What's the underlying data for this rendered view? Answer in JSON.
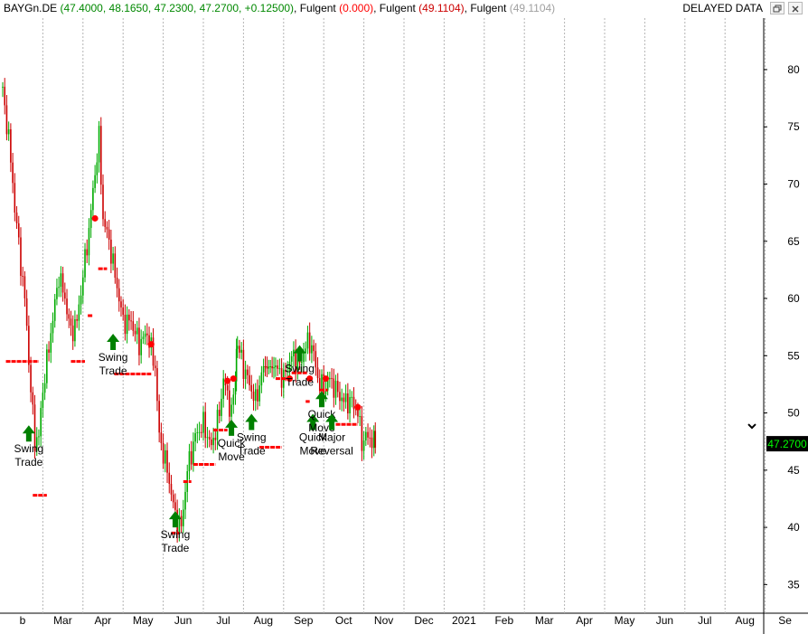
{
  "header": {
    "symbol": "BAYGn.DE",
    "ohlc": "(47.4000, 48.1650, 47.2300, 47.2700, +0.12500)",
    "ind1_name": "Fulgent",
    "ind1_value": "(0.000)",
    "ind2_name": "Fulgent",
    "ind2_value": "(49.1104)",
    "ind3_name": "Fulgent",
    "ind3_value": "(49.1104)",
    "status": "DELAYED DATA",
    "colors": {
      "symbol": "#000000",
      "ohlc": "#008800",
      "ind1": "#ff0000",
      "ind2": "#cc0000",
      "ind3": "#a0a0a0"
    },
    "window_icons": [
      "restore-icon",
      "close-icon"
    ]
  },
  "chart_data": {
    "type": "candlestick",
    "x_axis_labels": [
      {
        "label": "b",
        "month_index": 0
      },
      {
        "label": "Mar",
        "month_index": 1
      },
      {
        "label": "Apr",
        "month_index": 2
      },
      {
        "label": "May",
        "month_index": 3
      },
      {
        "label": "Jun",
        "month_index": 4
      },
      {
        "label": "Jul",
        "month_index": 5
      },
      {
        "label": "Aug",
        "month_index": 6
      },
      {
        "label": "Sep",
        "month_index": 7
      },
      {
        "label": "Oct",
        "month_index": 8
      },
      {
        "label": "Nov",
        "month_index": 9
      },
      {
        "label": "Dec",
        "month_index": 10
      },
      {
        "label": "2021",
        "month_index": 11
      },
      {
        "label": "Feb",
        "month_index": 12
      },
      {
        "label": "Mar",
        "month_index": 13
      },
      {
        "label": "Apr",
        "month_index": 14
      },
      {
        "label": "May",
        "month_index": 15
      },
      {
        "label": "Jun",
        "month_index": 16
      },
      {
        "label": "Jul",
        "month_index": 17
      },
      {
        "label": "Aug",
        "month_index": 18
      },
      {
        "label": "Se",
        "month_index": 19
      }
    ],
    "y_ticks": [
      35,
      40,
      45,
      50,
      55,
      60,
      65,
      70,
      75,
      80
    ],
    "ylim": [
      32.5,
      84.5
    ],
    "last_price": "47.2700",
    "last_price_value": 47.27,
    "colors": {
      "up": "#00aa00",
      "down": "#cc0000",
      "stop_line": "#ff0000",
      "stop_dot": "#ff0000",
      "arrow": "#008000",
      "grid": "#b4b4b4",
      "last_price_bg": "#000000",
      "last_price_fg": "#00ff00"
    },
    "price_path": [
      [
        0,
        78
      ],
      [
        0.15,
        74
      ],
      [
        0.3,
        68
      ],
      [
        0.45,
        63
      ],
      [
        0.55,
        60
      ],
      [
        0.7,
        52
      ],
      [
        0.8,
        47.5
      ],
      [
        0.9,
        48
      ],
      [
        1.0,
        52
      ],
      [
        1.2,
        57
      ],
      [
        1.4,
        62
      ],
      [
        1.55,
        60
      ],
      [
        1.7,
        57
      ],
      [
        1.85,
        58
      ],
      [
        2.0,
        62
      ],
      [
        2.15,
        66
      ],
      [
        2.3,
        71
      ],
      [
        2.4,
        74
      ],
      [
        2.5,
        67
      ],
      [
        2.65,
        65
      ],
      [
        2.8,
        62
      ],
      [
        3.0,
        58
      ],
      [
        3.2,
        58
      ],
      [
        3.4,
        56
      ],
      [
        3.6,
        57
      ],
      [
        3.8,
        54
      ],
      [
        3.9,
        48
      ],
      [
        4.1,
        45
      ],
      [
        4.3,
        41
      ],
      [
        4.45,
        40
      ],
      [
        4.6,
        45
      ],
      [
        4.8,
        48
      ],
      [
        5.0,
        49
      ],
      [
        5.2,
        47
      ],
      [
        5.4,
        50
      ],
      [
        5.5,
        53
      ],
      [
        5.7,
        50
      ],
      [
        5.8,
        53
      ],
      [
        5.85,
        56
      ],
      [
        6.0,
        54
      ],
      [
        6.2,
        52
      ],
      [
        6.3,
        51
      ],
      [
        6.5,
        54
      ],
      [
        6.8,
        54
      ],
      [
        7.0,
        53
      ],
      [
        7.2,
        55
      ],
      [
        7.4,
        54
      ],
      [
        7.55,
        56
      ],
      [
        7.7,
        56
      ],
      [
        7.85,
        53
      ],
      [
        8.0,
        52
      ],
      [
        8.15,
        53
      ],
      [
        8.3,
        52
      ],
      [
        8.5,
        51
      ],
      [
        8.7,
        51
      ],
      [
        8.85,
        50
      ],
      [
        8.95,
        47.5
      ],
      [
        9.1,
        48
      ],
      [
        9.25,
        47.4
      ],
      [
        9.32,
        47.3
      ]
    ],
    "stop_segments": [
      [
        0.08,
        54.5,
        0.9,
        54.5
      ],
      [
        0.75,
        42.8,
        1.1,
        42.8
      ],
      [
        1.7,
        54.5,
        2.05,
        54.5
      ],
      [
        2.12,
        58.5,
        2.25,
        58.5
      ],
      [
        2.38,
        62.6,
        2.6,
        62.6
      ],
      [
        2.78,
        53.4,
        3.7,
        53.4
      ],
      [
        4.2,
        39.5,
        4.4,
        39.5
      ],
      [
        4.5,
        44,
        4.7,
        44
      ],
      [
        4.75,
        45.5,
        5.3,
        45.5
      ],
      [
        5.25,
        48.5,
        5.6,
        48.5
      ],
      [
        6.4,
        47,
        6.95,
        47
      ],
      [
        6.8,
        53,
        7.15,
        53
      ],
      [
        7.2,
        53.5,
        7.6,
        53.5
      ],
      [
        7.55,
        51,
        7.65,
        51
      ],
      [
        7.9,
        52,
        8.1,
        52
      ],
      [
        8.3,
        49,
        8.85,
        49
      ]
    ],
    "stop_dots": [
      [
        2.3,
        67
      ],
      [
        3.7,
        56
      ],
      [
        5.6,
        52.8
      ],
      [
        5.75,
        53
      ],
      [
        7.15,
        53
      ],
      [
        7.65,
        53
      ],
      [
        8.05,
        53
      ],
      [
        8.85,
        50.5
      ]
    ],
    "annotations": [
      {
        "label": "Swing\nTrade",
        "x": 0.65,
        "y": 47.5
      },
      {
        "label": "Swing\nTrade",
        "x": 2.75,
        "y": 55.5
      },
      {
        "label": "Swing\nTrade",
        "x": 4.3,
        "y": 40
      },
      {
        "label": "Quick\nMove",
        "x": 5.7,
        "y": 48
      },
      {
        "label": "Swing\nTrade",
        "x": 6.2,
        "y": 48.5
      },
      {
        "label": "Swing\nTrade",
        "x": 7.4,
        "y": 54.5
      },
      {
        "label": "Quick\nMove",
        "x": 7.73,
        "y": 48.5
      },
      {
        "label": "Quick\nMove",
        "x": 7.95,
        "y": 50.5
      },
      {
        "label": "Major\nReversal",
        "x": 8.2,
        "y": 48.5
      }
    ]
  }
}
